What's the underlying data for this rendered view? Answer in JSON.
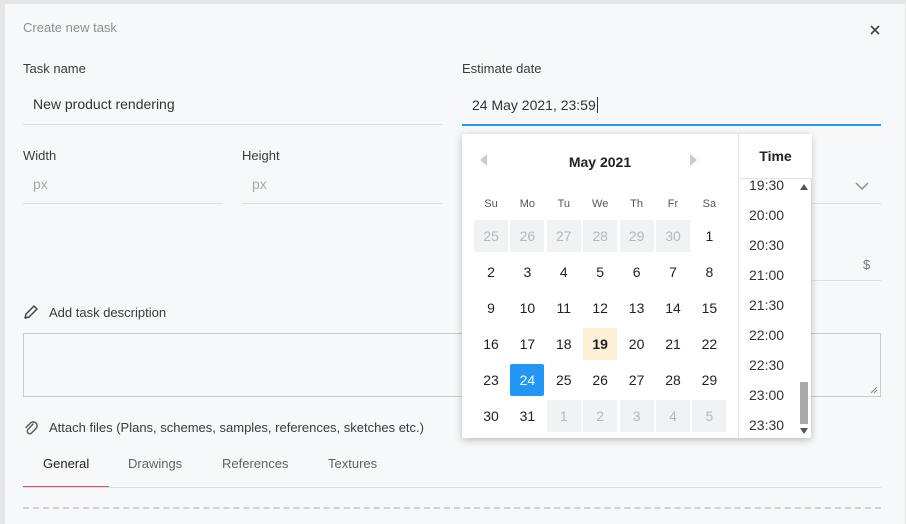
{
  "dialog": {
    "title": "Create new task",
    "close_icon": "close-icon"
  },
  "task_name": {
    "label": "Task name",
    "value": "New product rendering"
  },
  "estimate_date": {
    "label": "Estimate date",
    "value": "24 May 2021, 23:59"
  },
  "width": {
    "label": "Width",
    "placeholder": "px"
  },
  "height": {
    "label": "Height",
    "placeholder": "px"
  },
  "price": {
    "suffix": "$"
  },
  "description": {
    "label": "Add task description",
    "icon": "pencil-icon"
  },
  "attach": {
    "label": "Attach files (Plans, schemes, samples, references, sketches etc.)",
    "icon": "paperclip-icon"
  },
  "tabs": [
    {
      "label": "General",
      "active": true
    },
    {
      "label": "Drawings",
      "active": false
    },
    {
      "label": "References",
      "active": false
    },
    {
      "label": "Textures",
      "active": false
    }
  ],
  "calendar": {
    "month_title": "May 2021",
    "weekdays": [
      "Su",
      "Mo",
      "Tu",
      "We",
      "Th",
      "Fr",
      "Sa"
    ],
    "weeks": [
      [
        {
          "d": "25",
          "m": true
        },
        {
          "d": "26",
          "m": true
        },
        {
          "d": "27",
          "m": true
        },
        {
          "d": "28",
          "m": true
        },
        {
          "d": "29",
          "m": true
        },
        {
          "d": "30",
          "m": true
        },
        {
          "d": "1"
        }
      ],
      [
        {
          "d": "2"
        },
        {
          "d": "3"
        },
        {
          "d": "4"
        },
        {
          "d": "5"
        },
        {
          "d": "6"
        },
        {
          "d": "7"
        },
        {
          "d": "8"
        }
      ],
      [
        {
          "d": "9"
        },
        {
          "d": "10"
        },
        {
          "d": "11"
        },
        {
          "d": "12"
        },
        {
          "d": "13"
        },
        {
          "d": "14"
        },
        {
          "d": "15"
        }
      ],
      [
        {
          "d": "16"
        },
        {
          "d": "17"
        },
        {
          "d": "18"
        },
        {
          "d": "19",
          "today": true
        },
        {
          "d": "20"
        },
        {
          "d": "21"
        },
        {
          "d": "22"
        }
      ],
      [
        {
          "d": "23"
        },
        {
          "d": "24",
          "selected": true
        },
        {
          "d": "25"
        },
        {
          "d": "26"
        },
        {
          "d": "27"
        },
        {
          "d": "28"
        },
        {
          "d": "29"
        }
      ],
      [
        {
          "d": "30"
        },
        {
          "d": "31"
        },
        {
          "d": "1",
          "m": true
        },
        {
          "d": "2",
          "m": true
        },
        {
          "d": "3",
          "m": true
        },
        {
          "d": "4",
          "m": true
        },
        {
          "d": "5",
          "m": true
        }
      ]
    ]
  },
  "time": {
    "header": "Time",
    "items": [
      "19:30",
      "20:00",
      "20:30",
      "21:00",
      "21:30",
      "22:00",
      "22:30",
      "23:00",
      "23:30"
    ]
  },
  "colors": {
    "accent": "#2196f3",
    "today": "#fdf0d6",
    "tab_indicator": "#d9506f"
  }
}
